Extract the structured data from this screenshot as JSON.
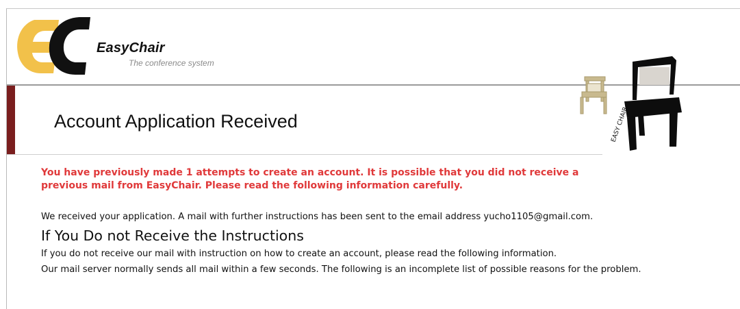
{
  "header": {
    "logo_name": "EasyChair",
    "logo_tagline": "The conference system",
    "logo_letters": "EC",
    "colors": {
      "logo_e": "#f2c14a",
      "logo_c": "#111111",
      "accent": "#7a1e1e"
    },
    "side_art_text": "EASY CHAIR"
  },
  "page": {
    "title": "Account Application Received"
  },
  "notice": {
    "warning": "You have previously made 1 attempts to create an account. It is possible that you did not receive a previous mail from EasyChair. Please read the following information carefully.",
    "warning_color": "#e0393a",
    "received": "We received your application. A mail with further instructions has been sent to the email address yucho1105@gmail.com."
  },
  "help": {
    "heading": "If You Do not Receive the Instructions",
    "paragraph_1": "If you do not receive our mail with instruction on how to create an account, please read the following information.",
    "paragraph_2": "Our mail server normally sends all mail within a few seconds. The following is an incomplete list of possible reasons for the problem."
  }
}
